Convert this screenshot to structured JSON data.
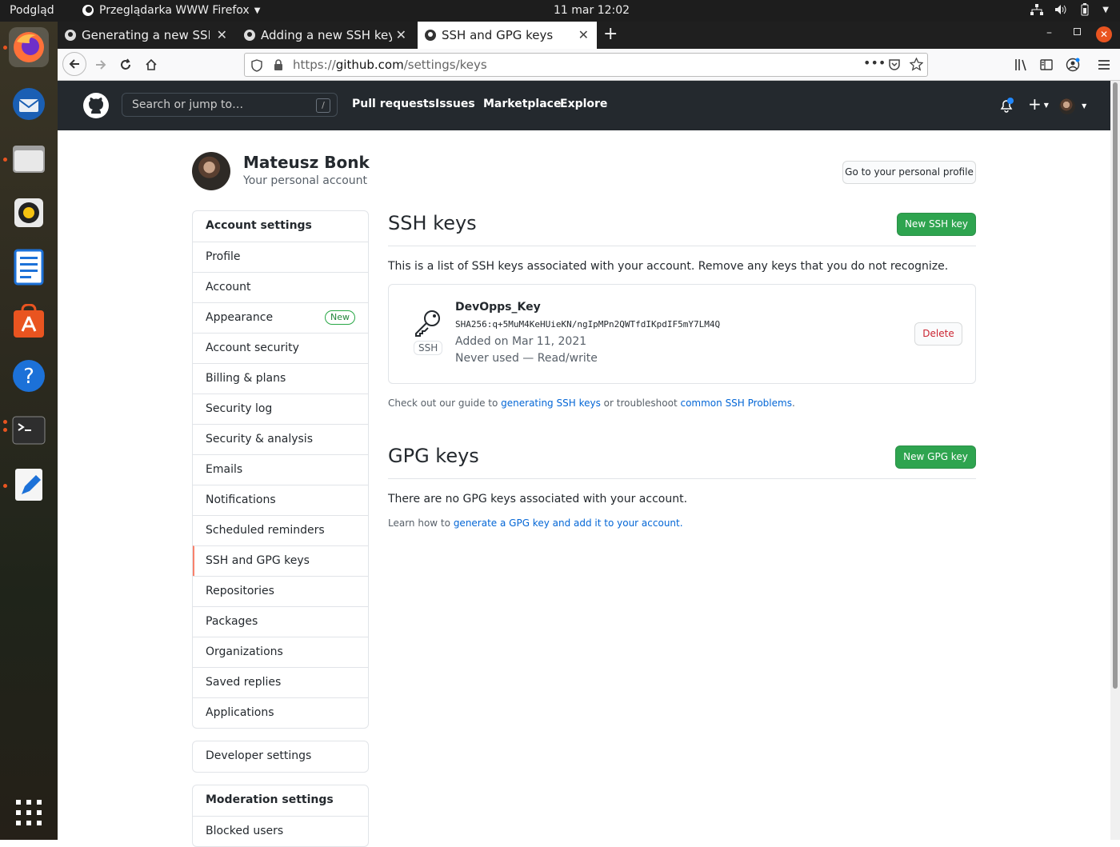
{
  "system": {
    "activities": "Podgląd",
    "app_menu": "Przeglądarka WWW Firefox",
    "clock": "11 mar  12:02"
  },
  "browser": {
    "tabs": [
      {
        "title": "Generating a new SSH key",
        "active": false
      },
      {
        "title": "Adding a new SSH key to",
        "active": false
      },
      {
        "title": "SSH and GPG keys",
        "active": true
      }
    ],
    "url_prefix": "https://",
    "url_domain": "github.com",
    "url_path": "/settings/keys"
  },
  "github": {
    "search_placeholder": "Search or jump to…",
    "search_shortcut": "/",
    "nav": [
      "Pull requests",
      "Issues",
      "Marketplace",
      "Explore"
    ]
  },
  "profile": {
    "name": "Mateusz Bonk",
    "subtitle": "Your personal account",
    "profile_button": "Go to your personal profile"
  },
  "sidebar": {
    "account_settings": [
      {
        "label": "Account settings"
      },
      {
        "label": "Profile"
      },
      {
        "label": "Account"
      },
      {
        "label": "Appearance",
        "badge": "New"
      },
      {
        "label": "Account security"
      },
      {
        "label": "Billing & plans"
      },
      {
        "label": "Security log"
      },
      {
        "label": "Security & analysis"
      },
      {
        "label": "Emails"
      },
      {
        "label": "Notifications"
      },
      {
        "label": "Scheduled reminders"
      },
      {
        "label": "SSH and GPG keys",
        "selected": true
      },
      {
        "label": "Repositories"
      },
      {
        "label": "Packages"
      },
      {
        "label": "Organizations"
      },
      {
        "label": "Saved replies"
      },
      {
        "label": "Applications"
      }
    ],
    "developer_settings": "Developer settings",
    "moderation": [
      "Moderation settings",
      "Blocked users"
    ]
  },
  "ssh": {
    "title": "SSH keys",
    "new_button": "New SSH key",
    "description": "This is a list of SSH keys associated with your account. Remove any keys that you do not recognize.",
    "key": {
      "badge": "SSH",
      "name": "DevOpps_Key",
      "fingerprint": "SHA256:q+5MuM4KeHUieKN/ngIpMPn2QWTfdIKpdIF5mY7LM4Q",
      "added": "Added on Mar 11, 2021",
      "usage": "Never used — Read/write",
      "delete_label": "Delete"
    },
    "guide_prefix": "Check out our guide to",
    "guide_link": "generating SSH keys",
    "guide_middle": "or troubleshoot",
    "guide_link2": "common SSH Problems",
    "guide_suffix": "."
  },
  "gpg": {
    "title": "GPG keys",
    "new_button": "New GPG key",
    "empty": "There are no GPG keys associated with your account.",
    "learn_prefix": "Learn how to",
    "learn_link": "generate a GPG key and add it to your account",
    "learn_suffix": "."
  }
}
